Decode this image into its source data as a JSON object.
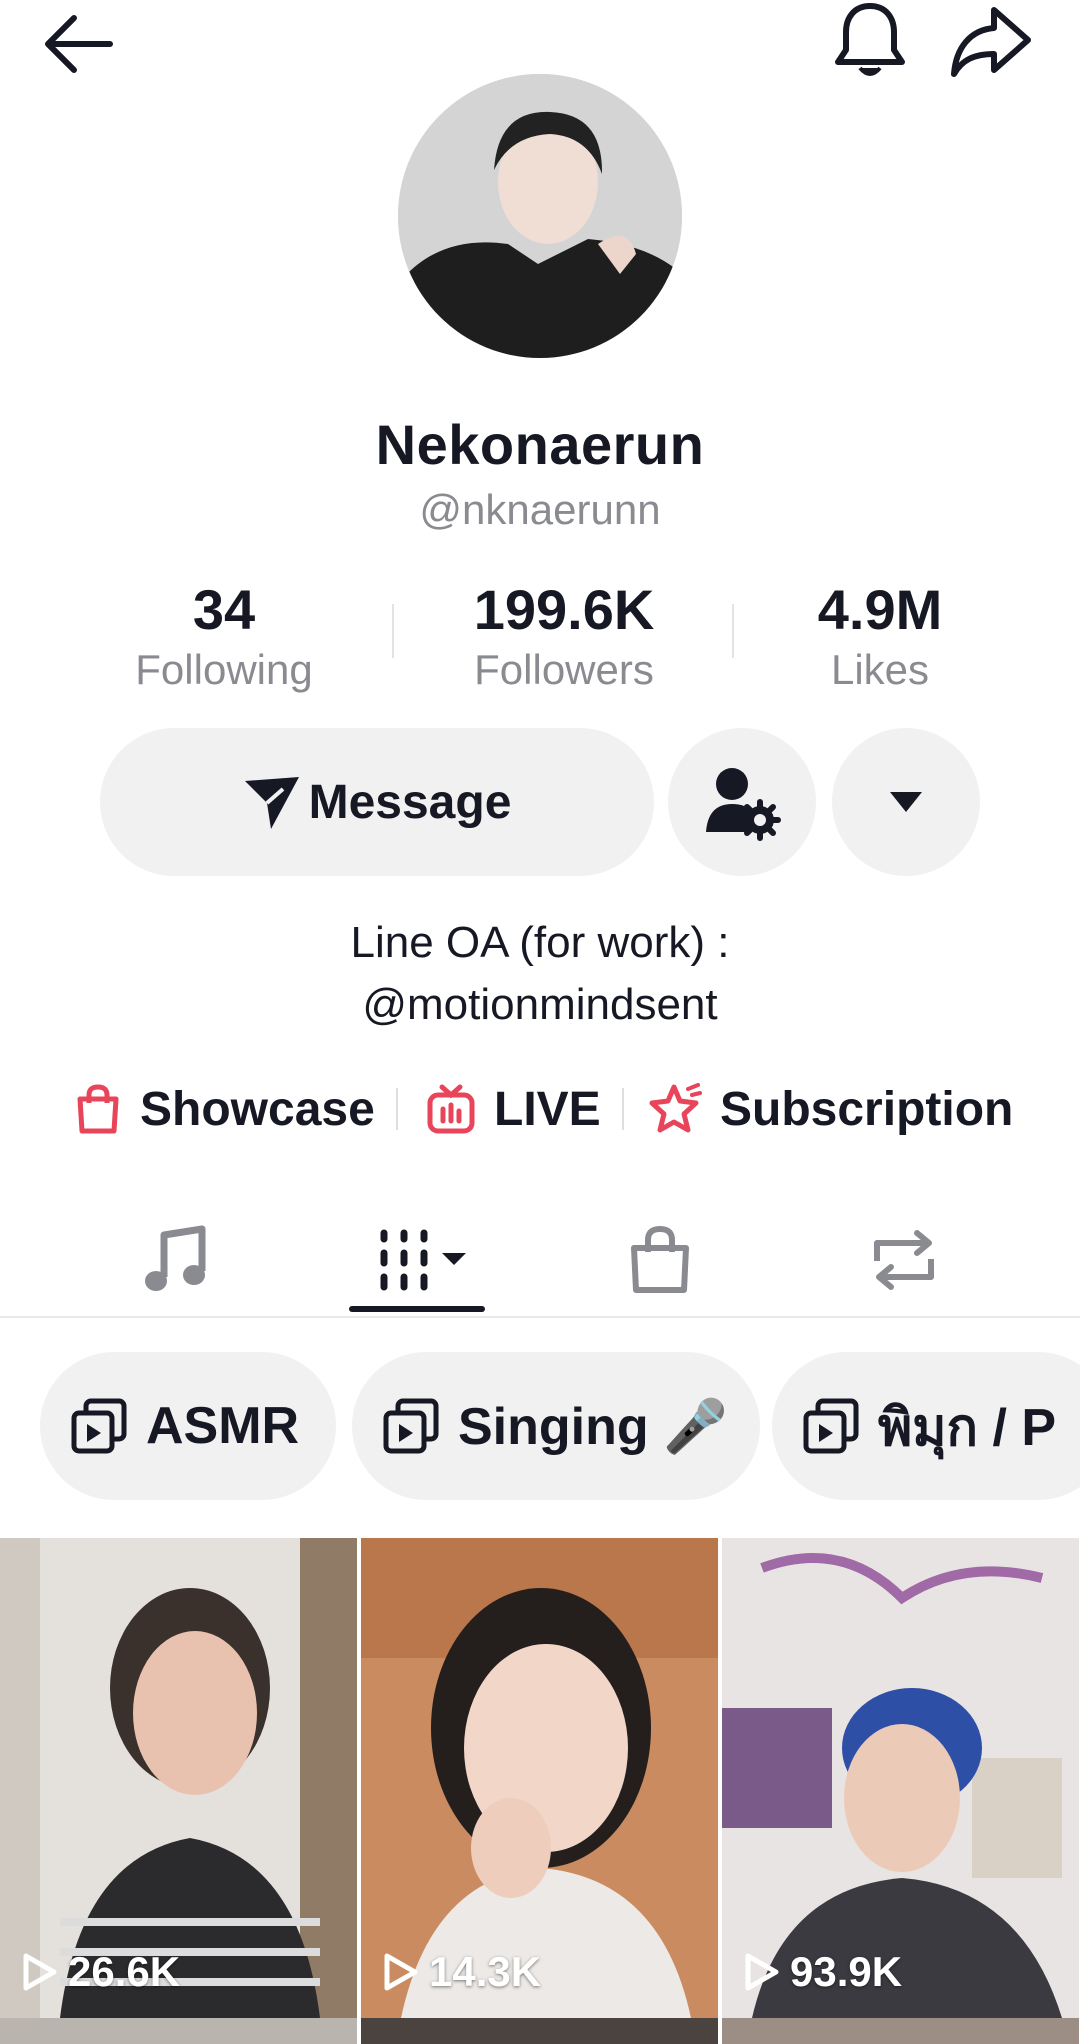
{
  "profile": {
    "display_name": "Nekonaerun",
    "handle": "@nknaerunn"
  },
  "stats": [
    {
      "value": "34",
      "label": "Following"
    },
    {
      "value": "199.6K",
      "label": "Followers"
    },
    {
      "value": "4.9M",
      "label": "Likes"
    }
  ],
  "actions": {
    "message_label": "Message"
  },
  "bio": {
    "line1": "Line OA (for work) :",
    "line2": "@motionmindsent"
  },
  "links": [
    {
      "label": "Showcase",
      "icon": "shopping-bag-icon"
    },
    {
      "label": "LIVE",
      "icon": "live-tv-icon"
    },
    {
      "label": "Subscription",
      "icon": "subscription-star-icon"
    }
  ],
  "tabs": [
    {
      "icon": "music-note-icon"
    },
    {
      "icon": "video-grid-icon",
      "selected": true
    },
    {
      "icon": "shopping-bag-icon"
    },
    {
      "icon": "repost-icon"
    }
  ],
  "collections": [
    {
      "label": "ASMR"
    },
    {
      "label": "Singing 🎤"
    },
    {
      "label": "พิมุก / P"
    }
  ],
  "videos": [
    {
      "views": "26.6K"
    },
    {
      "views": "14.3K"
    },
    {
      "views": "93.9K"
    }
  ],
  "colors": {
    "accent": "#e8445a",
    "text": "#161823",
    "secondary_text": "#8a8b91",
    "button_bg": "#f1f1f2"
  }
}
